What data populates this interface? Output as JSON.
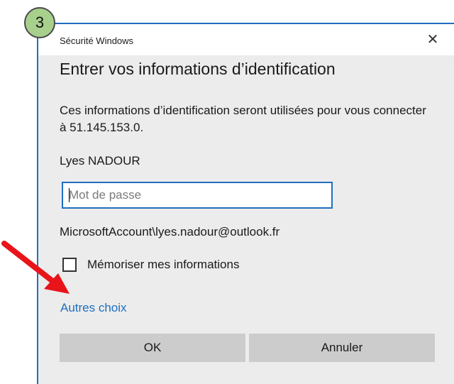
{
  "step_badge": "3",
  "dialog": {
    "title": "Sécurité Windows",
    "close_icon": "close-icon",
    "heading": "Entrer vos informations d’identification",
    "description": "Ces informations d’identification seront utilisées pour vous connecter à 51.145.153.0.",
    "username": "Lyes NADOUR",
    "password": {
      "value": "",
      "placeholder": "Mot de passe"
    },
    "account": "MicrosoftAccount\\lyes.nadour@outlook.fr",
    "remember": {
      "label": "Mémoriser mes informations",
      "checked": false
    },
    "other_choices": "Autres choix",
    "ok_label": "OK",
    "cancel_label": "Annuler"
  },
  "annotation": {
    "arrow_color": "#e8141a"
  },
  "colors": {
    "accent": "#1f6fbf",
    "dialog_bg": "#ececec",
    "button_bg": "#cccccc",
    "badge_bg": "#a8d08d"
  }
}
